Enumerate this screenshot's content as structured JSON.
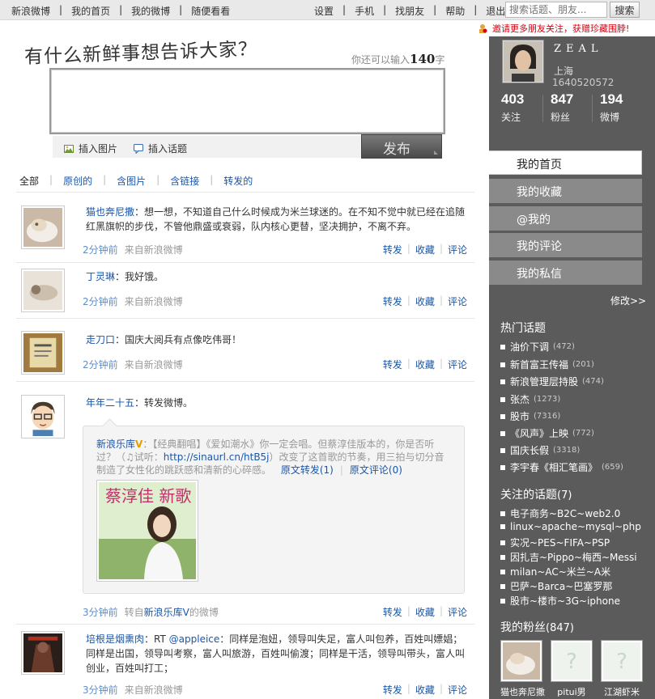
{
  "topnav": {
    "left": [
      "新浪微博",
      "我的首页",
      "我的微博",
      "随便看看"
    ],
    "right": [
      "设置",
      "手机",
      "找朋友",
      "帮助",
      "退出"
    ],
    "search_placeholder": "搜索话题、朋友...",
    "search_button": "搜索"
  },
  "invite": "邀请更多朋友关注，获赠珍藏围脖!",
  "compose": {
    "slogan": "有什么新鲜事想告诉大家？",
    "counter_prefix": "你还可以输入",
    "counter_value": "140",
    "counter_suffix": "字",
    "insert_image": "插入图片",
    "insert_topic": "插入话题",
    "publish": "发布"
  },
  "filters": [
    "全部",
    "原创的",
    "含图片",
    "含链接",
    "转发的"
  ],
  "posts": [
    {
      "author": "猫也奔尼撒",
      "text": "：想一想，不知道自己什么时候成为米兰球迷的。在不知不觉中就已经在追随红黑旗帜的步伐，不管他鼎盛或衰弱，队内核心更替，坚决拥护，不离不弃。",
      "time": "2分钟前",
      "source": "来自新浪微博"
    },
    {
      "author": "丁灵琳",
      "text": "：我好饿。",
      "time": "2分钟前",
      "source": "来自新浪微博"
    },
    {
      "author": "走刀口",
      "text": "：国庆大阅兵有点像吃伟哥！",
      "time": "2分钟前",
      "source": "来自新浪微博"
    },
    {
      "author": "年年二十五",
      "text": "：转发微博。",
      "time": "3分钟前",
      "source_prefix": "转自",
      "source_link": "新浪乐库V",
      "source_suffix": "的微博",
      "repost": {
        "author": "新浪乐库",
        "vbadge": "V",
        "text": "：【经典翻唱】《爱如潮水》你一定会唱。但蔡淳佳版本的，你是否听过？（♫试听：",
        "link": "http://sinaurl.cn/htB5j",
        "text2": "）改变了这首歌的节奏，用三拍与切分音制造了女性化的跳跃感和清新的心碎感。",
        "orig_repost": "原文转发(1)",
        "orig_comment": "原文评论(0)",
        "image_caption": "蔡淳佳 新歌"
      }
    },
    {
      "author": "培根是烟熏肉",
      "text_prefix": "：RT ",
      "mention": "@appleice",
      "text": "：同样是泡妞，领导叫失足，富人叫包养，百姓叫嫖娼；同样是出国，领导叫考察，富人叫旅游，百姓叫偷渡；同样是干活，领导叫带头，富人叫创业，百姓叫打工；",
      "time": "3分钟前",
      "source": "来自新浪微博"
    }
  ],
  "actions": {
    "forward": "转发",
    "favorite": "收藏",
    "comment": "评论"
  },
  "profile": {
    "name": "ZEAL",
    "location": "上海",
    "id": "1640520572",
    "following": "403",
    "following_label": "关注",
    "followers": "847",
    "followers_label": "粉丝",
    "posts": "194",
    "posts_label": "微博"
  },
  "menu": [
    "我的首页",
    "我的收藏",
    "@我的",
    "我的评论",
    "我的私信"
  ],
  "edit_link": "修改>>",
  "hot_topics_title": "热门话题",
  "hot_topics": [
    {
      "name": "油价下调",
      "count": "(472)"
    },
    {
      "name": "新首富王传福",
      "count": "(201)"
    },
    {
      "name": "新浪管理层持股",
      "count": "(474)"
    },
    {
      "name": "张杰",
      "count": "(1273)"
    },
    {
      "name": "股市",
      "count": "(7316)"
    },
    {
      "name": "《风声》上映",
      "count": "(772)"
    },
    {
      "name": "国庆长假",
      "count": "(3318)"
    },
    {
      "name": "李宇春《相汇笔画》",
      "count": "(659)"
    }
  ],
  "followed_topics_title": "关注的话题",
  "followed_topics_count": "(7)",
  "followed_topics": [
    "电子商务~B2C~web2.0",
    "linux~apache~mysql~php",
    "实况~PES~FIFA~PSP",
    "因扎吉~Pippo~梅西~Messi",
    "milan~AC~米兰~A米",
    "巴萨~Barca~巴塞罗那",
    "股市~楼市~3G~iphone"
  ],
  "fans_title": "我的粉丝",
  "fans_count": "(847)",
  "fans": [
    "猫也奔尼撒",
    "pitui男",
    "江湖虾米"
  ],
  "colors": {
    "link": "#1a56a8",
    "sidebar": "#5b5b5b",
    "invite": "#d4000e"
  }
}
